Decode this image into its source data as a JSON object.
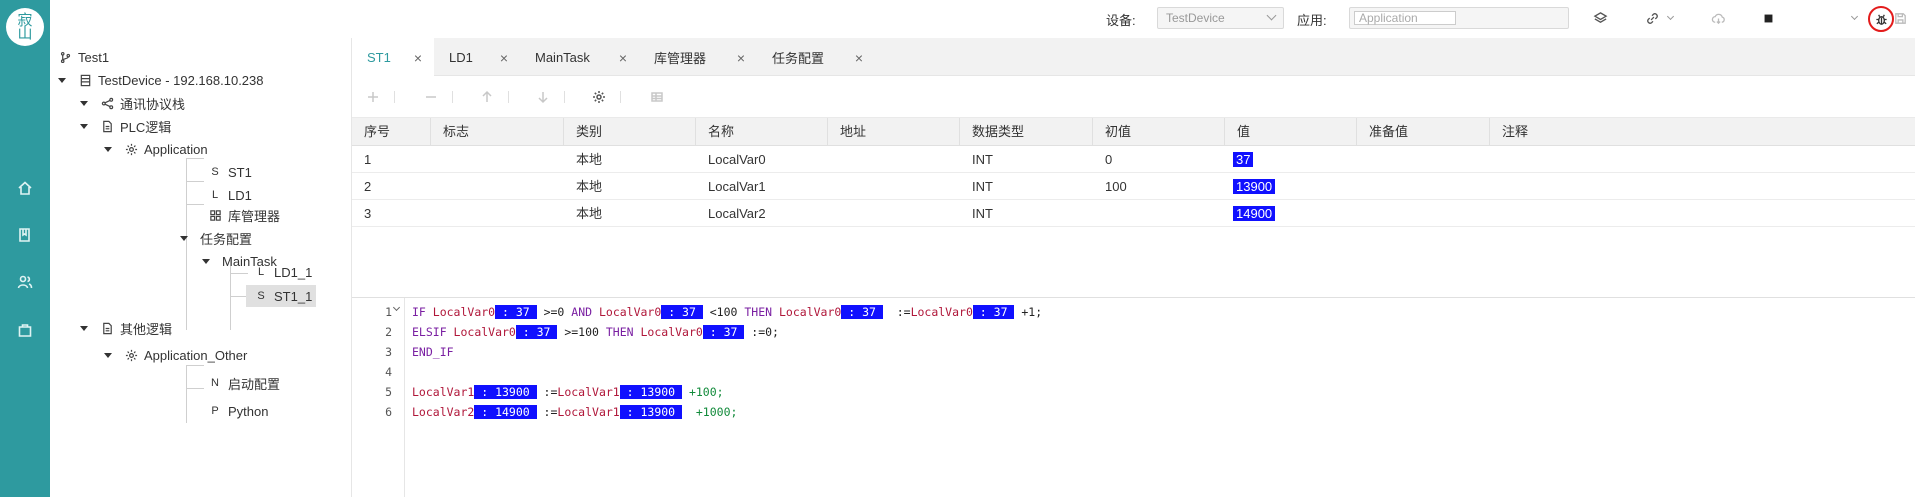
{
  "topbar": {
    "device_label": "设备:",
    "device_value": "TestDevice",
    "app_label": "应用:",
    "app_value": "Application"
  },
  "logo": {
    "text": "寂山"
  },
  "tree": {
    "nodes": [
      {
        "label": "Test1"
      },
      {
        "label": "TestDevice - 192.168.10.238"
      },
      {
        "label": "通讯协议栈"
      },
      {
        "label": "PLC逻辑"
      },
      {
        "label": "Application"
      },
      {
        "prefix": "S",
        "label": "ST1"
      },
      {
        "prefix": "L",
        "label": "LD1"
      },
      {
        "label": "库管理器"
      },
      {
        "label": "任务配置"
      },
      {
        "label": "MainTask"
      },
      {
        "prefix": "L",
        "label": "LD1_1"
      },
      {
        "prefix": "S",
        "label": "ST1_1"
      },
      {
        "label": "其他逻辑"
      },
      {
        "label": "Application_Other"
      },
      {
        "prefix": "N",
        "label": "启动配置"
      },
      {
        "prefix": "P",
        "label": "Python"
      }
    ]
  },
  "tabs": [
    {
      "label": "ST1",
      "active": true
    },
    {
      "label": "LD1"
    },
    {
      "label": "MainTask"
    },
    {
      "label": "库管理器"
    },
    {
      "label": "任务配置"
    }
  ],
  "table": {
    "headers": [
      "序号",
      "标志",
      "类别",
      "名称",
      "地址",
      "数据类型",
      "初值",
      "值",
      "准备值",
      "注释"
    ],
    "rows": [
      {
        "index": "1",
        "flag": "",
        "category": "本地",
        "name": "LocalVar0",
        "address": "",
        "type": "INT",
        "init": "0",
        "value": "37",
        "prepared": "",
        "comment": ""
      },
      {
        "index": "2",
        "flag": "",
        "category": "本地",
        "name": "LocalVar1",
        "address": "",
        "type": "INT",
        "init": "100",
        "value": "13900",
        "prepared": "",
        "comment": ""
      },
      {
        "index": "3",
        "flag": "",
        "category": "本地",
        "name": "LocalVar2",
        "address": "",
        "type": "INT",
        "init": "",
        "value": "14900",
        "prepared": "",
        "comment": ""
      }
    ]
  },
  "editor": {
    "line_numbers": [
      "1",
      "2",
      "3",
      "4",
      "5",
      "6"
    ],
    "lines": [
      [
        {
          "t": "IF ",
          "c": "kw"
        },
        {
          "t": "LocalVar0",
          "c": "var"
        },
        {
          "t": " : 37 ",
          "c": "hl"
        },
        {
          "t": " >=0 ",
          "c": "op"
        },
        {
          "t": "AND ",
          "c": "kw"
        },
        {
          "t": "LocalVar0",
          "c": "var"
        },
        {
          "t": " : 37 ",
          "c": "hl"
        },
        {
          "t": " <100 ",
          "c": "op"
        },
        {
          "t": "THEN ",
          "c": "kw"
        },
        {
          "t": "LocalVar0",
          "c": "var"
        },
        {
          "t": " : 37 ",
          "c": "hl"
        },
        {
          "t": "  :=",
          "c": "op"
        },
        {
          "t": "LocalVar0",
          "c": "var"
        },
        {
          "t": " : 37 ",
          "c": "hl"
        },
        {
          "t": " +1;",
          "c": "op"
        }
      ],
      [
        {
          "t": "ELSIF ",
          "c": "kw"
        },
        {
          "t": "LocalVar0",
          "c": "var"
        },
        {
          "t": " : 37 ",
          "c": "hl"
        },
        {
          "t": " >=100 ",
          "c": "op"
        },
        {
          "t": "THEN ",
          "c": "kw"
        },
        {
          "t": "LocalVar0",
          "c": "var"
        },
        {
          "t": " : 37 ",
          "c": "hl"
        },
        {
          "t": " :=0;",
          "c": "op"
        }
      ],
      [
        {
          "t": "END_IF",
          "c": "kw"
        }
      ],
      [],
      [
        {
          "t": "LocalVar1",
          "c": "var"
        },
        {
          "t": " : 13900 ",
          "c": "hl"
        },
        {
          "t": " :=",
          "c": "op"
        },
        {
          "t": "LocalVar1",
          "c": "var"
        },
        {
          "t": " : 13900 ",
          "c": "hl"
        },
        {
          "t": " +100;",
          "c": "num"
        }
      ],
      [
        {
          "t": "LocalVar2",
          "c": "var"
        },
        {
          "t": " : 14900 ",
          "c": "hl"
        },
        {
          "t": " :=",
          "c": "op"
        },
        {
          "t": "LocalVar1",
          "c": "var"
        },
        {
          "t": " : 13900 ",
          "c": "hl"
        },
        {
          "t": "  +1000;",
          "c": "num"
        }
      ]
    ]
  },
  "colors": {
    "rail": "#2e9a9f",
    "accent": "#2e9a9f",
    "highlight": "#1010ff",
    "debug_ring": "#e31b1b"
  }
}
